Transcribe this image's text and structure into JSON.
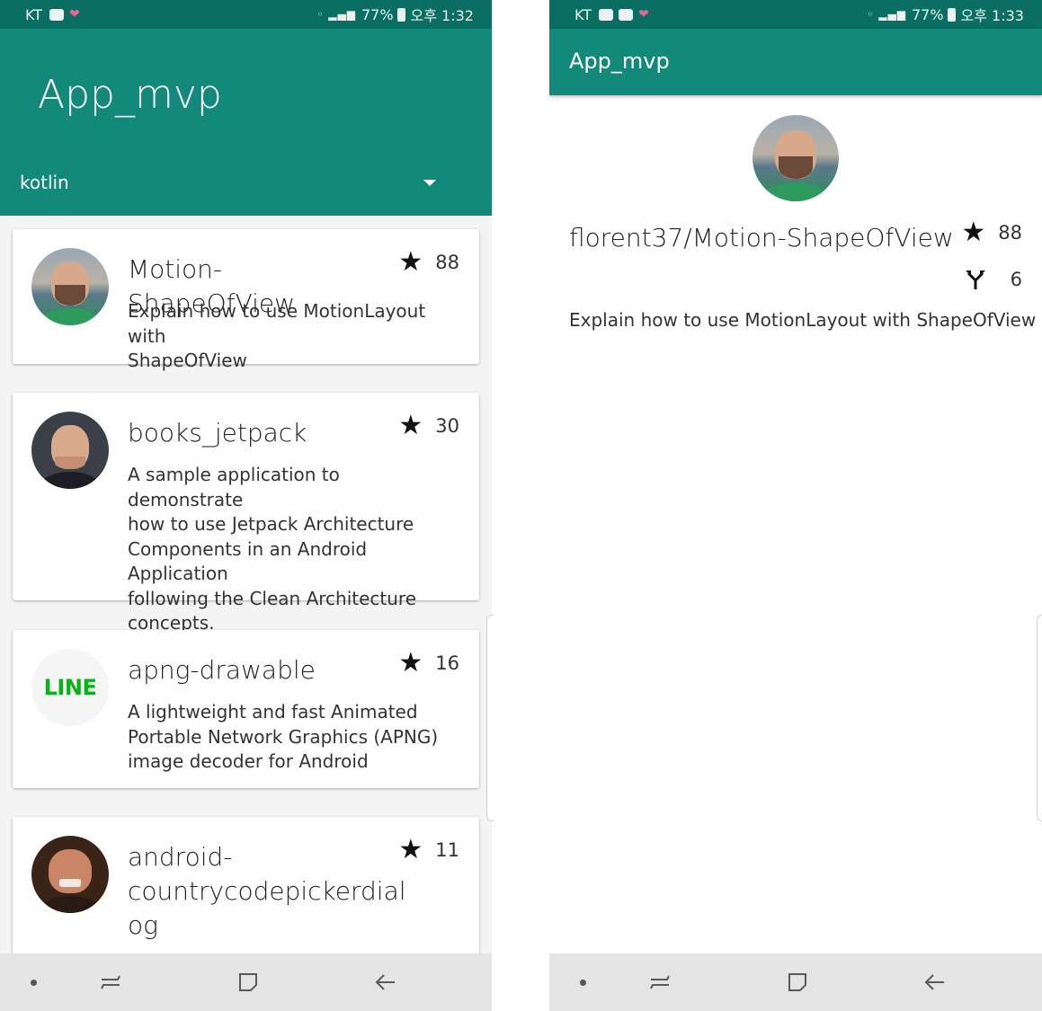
{
  "left_screen": {
    "status_bar": {
      "carrier": "KT",
      "battery": "77%",
      "time": "오후 1:32"
    },
    "app_bar": {
      "title": "App_mvp",
      "spinner_value": "kotlin"
    },
    "repos": [
      {
        "name": "Motion-ShapeOfView",
        "description_lines": [
          "Explain how to use MotionLayout with",
          "ShapeOfView"
        ],
        "stars": "88",
        "avatar": "person-avatar"
      },
      {
        "name": "books_jetpack",
        "description_lines": [
          "A sample application to demonstrate",
          "how to use Jetpack Architecture",
          "Components in an Android Application",
          "following the Clean Architecture",
          "concepts."
        ],
        "stars": "30",
        "avatar": "person-avatar"
      },
      {
        "name": "apng-drawable",
        "description_lines": [
          "A lightweight and fast Animated",
          "Portable Network Graphics (APNG)",
          "image decoder for Android"
        ],
        "stars": "16",
        "avatar": "line-logo",
        "logo_text": "LINE"
      },
      {
        "name_lines": [
          "android-",
          "countrycodepickerdial",
          "og"
        ],
        "stars": "11",
        "avatar": "person-avatar"
      }
    ]
  },
  "right_screen": {
    "status_bar": {
      "carrier": "KT",
      "battery": "77%",
      "time": "오후 1:33"
    },
    "app_bar": {
      "title": "App_mvp"
    },
    "detail": {
      "full_name": "florent37/Motion-ShapeOfView",
      "stars": "88",
      "forks": "6",
      "description": "Explain how to use MotionLayout with ShapeOfView"
    }
  },
  "icons": {
    "star": "star-icon",
    "fork": "fork-icon",
    "nav": [
      "recents-dot-icon",
      "recent-apps-icon",
      "home-icon",
      "back-icon"
    ]
  },
  "colors": {
    "primary": "#13897b",
    "primary_dark": "#0a6e62",
    "line_green": "#08b219"
  }
}
